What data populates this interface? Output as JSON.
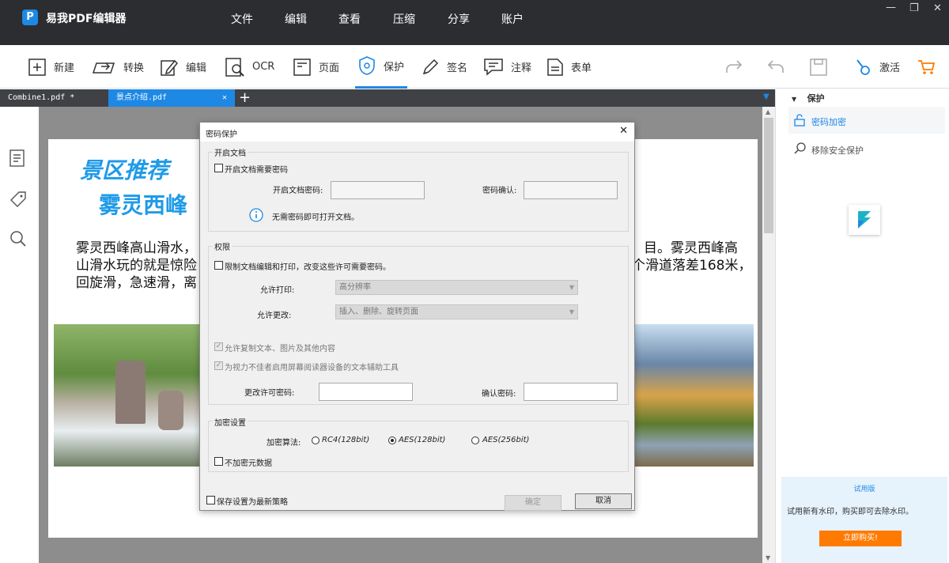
{
  "app": {
    "name": "易我PDF编辑器",
    "logo_letter": "P"
  },
  "menu": [
    "文件",
    "编辑",
    "查看",
    "压缩",
    "分享",
    "账户"
  ],
  "toolbar": {
    "items": [
      "新建",
      "转换",
      "编辑",
      "OCR",
      "页面",
      "保护",
      "签名",
      "注释",
      "表单"
    ],
    "activate": "激活"
  },
  "tabs": [
    {
      "label": "Combine1.pdf *"
    },
    {
      "label": "景点介绍.pdf"
    }
  ],
  "document": {
    "heading1": "景区推荐",
    "heading2": "雾灵西峰",
    "para_line1_left": "雾灵西峰高山滑水，",
    "para_line1_right": "目。雾灵西峰高",
    "para_line2_left": "山滑水玩的就是惊险",
    "para_line2_right": "个滑道落差168米，",
    "para_line3_left": "回旋滑，急速滑，离"
  },
  "right_panel": {
    "section": "保护",
    "items": [
      "密码加密",
      "移除安全保护"
    ],
    "trial_title": "试用版",
    "trial_text": "试用新有水印，购买即可去除水印。",
    "buy_button": "立即购买!"
  },
  "dialog": {
    "title": "密码保护",
    "open_group": "开启文档",
    "open_require": "开启文档需要密码",
    "open_pwd_label": "开启文档密码:",
    "confirm_label": "密码确认:",
    "open_info": "无需密码即可打开文档。",
    "perm_group": "权限",
    "perm_restrict": "限制文档编辑和打印，改变这些许可需要密码。",
    "allow_print_label": "允许打印:",
    "allow_print_value": "高分辨率",
    "allow_change_label": "允许更改:",
    "allow_change_value": "插入、删除、旋转页面",
    "allow_copy": "允许复制文本、图片及其他内容",
    "allow_access": "为视力不佳者启用屏幕阅读器设备的文本辅助工具",
    "change_pwd_label": "更改许可密码:",
    "confirm_pwd_label": "确认密码:",
    "enc_group": "加密设置",
    "algo_label": "加密算法:",
    "algo_options": [
      "RC4(128bit)",
      "AES(128bit)",
      "AES(256bit)"
    ],
    "algo_selected": "AES(128bit)",
    "no_meta": "不加密元数据",
    "save_default": "保存设置为最新策略",
    "ok": "确定",
    "cancel": "取消"
  },
  "colors": {
    "accent": "#1e88e5",
    "titlebar": "#2b2d31",
    "heading": "#1f9ae8",
    "buy": "#ff7a00",
    "cart": "#ff7a00"
  }
}
